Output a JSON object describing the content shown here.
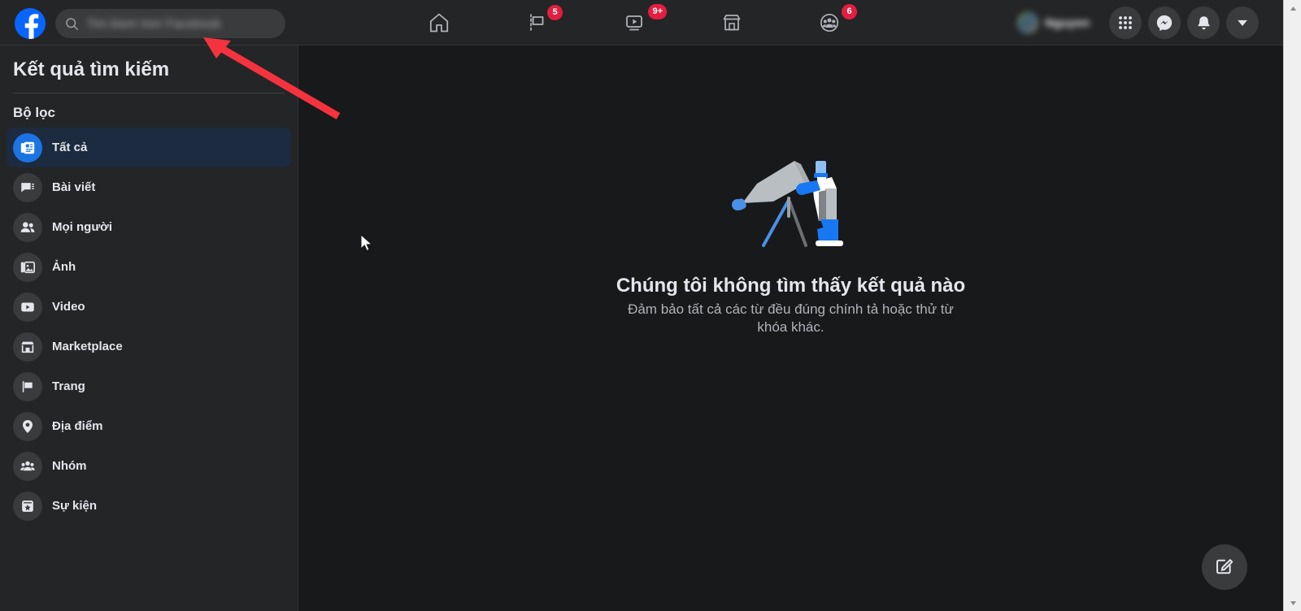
{
  "topbar": {
    "logo_label": "Facebook",
    "search": {
      "value": "",
      "placeholder": "Tìm kiếm trên Facebook",
      "icon": "search-icon",
      "redacted": true
    },
    "nav": [
      {
        "name": "home",
        "icon": "home-icon",
        "badge": ""
      },
      {
        "name": "pages",
        "icon": "flag-icon",
        "badge": "5"
      },
      {
        "name": "watch",
        "icon": "video-icon",
        "badge": "9+"
      },
      {
        "name": "marketplace",
        "icon": "store-icon",
        "badge": ""
      },
      {
        "name": "groups",
        "icon": "groups-icon",
        "badge": "6"
      }
    ],
    "profile": {
      "name": "",
      "redacted": true
    },
    "actions": [
      {
        "name": "menu-grid",
        "icon": "grid-icon"
      },
      {
        "name": "messenger",
        "icon": "messenger-icon"
      },
      {
        "name": "notifications",
        "icon": "bell-icon"
      },
      {
        "name": "account",
        "icon": "chevron-down-icon"
      }
    ]
  },
  "sidebar": {
    "title": "Kết quả tìm kiếm",
    "filters_heading": "Bộ lọc",
    "items": [
      {
        "label": "Tất cả",
        "icon": "all-results-icon",
        "active": true
      },
      {
        "label": "Bài viết",
        "icon": "posts-icon",
        "active": false
      },
      {
        "label": "Mọi người",
        "icon": "people-icon",
        "active": false
      },
      {
        "label": "Ảnh",
        "icon": "photo-icon",
        "active": false
      },
      {
        "label": "Video",
        "icon": "video-icon",
        "active": false
      },
      {
        "label": "Marketplace",
        "icon": "store-icon",
        "active": false
      },
      {
        "label": "Trang",
        "icon": "flag-icon",
        "active": false
      },
      {
        "label": "Địa điểm",
        "icon": "location-pin-icon",
        "active": false
      },
      {
        "label": "Nhóm",
        "icon": "groups-icon",
        "active": false
      },
      {
        "label": "Sự kiện",
        "icon": "event-icon",
        "active": false
      }
    ]
  },
  "main": {
    "empty_state": {
      "illustration": "telescope-illustration",
      "title": "Chúng tôi không tìm thấy kết quả nào",
      "subtitle": "Đảm bảo tất cả các từ đều đúng chính tả hoặc thử từ khóa khác."
    }
  },
  "fab": {
    "name": "compose-button",
    "icon": "compose-icon"
  },
  "annotation": {
    "type": "arrow",
    "color": "#f5333f",
    "points_to": "search-input"
  },
  "colors": {
    "background": "#18191a",
    "surface": "#242526",
    "input": "#3a3b3c",
    "accent": "#1b74e4",
    "brand": "#0866ff",
    "badge": "#e41e3f",
    "active_filter_bg": "#1c2b3f",
    "text_primary": "#e4e6eb",
    "text_secondary": "#b0b3b8",
    "annotation": "#f5333f"
  }
}
